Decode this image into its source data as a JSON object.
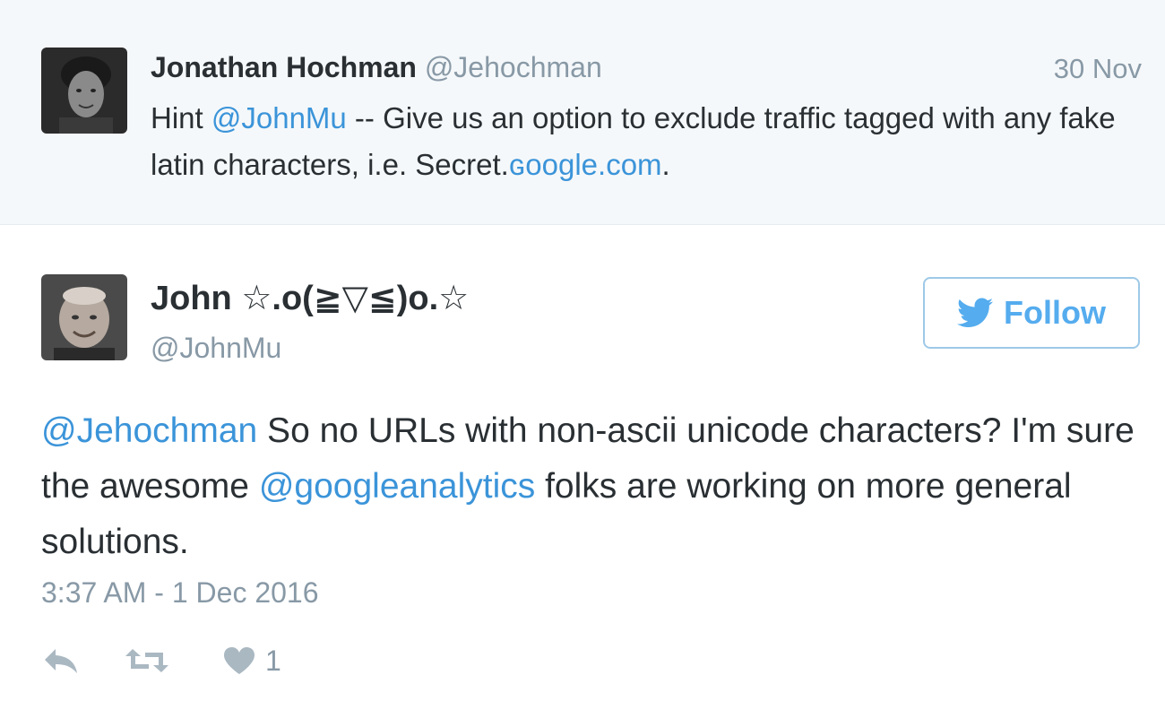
{
  "parent_tweet": {
    "fullname": "Jonathan Hochman",
    "username": "@Jehochman",
    "time": "30 Nov",
    "text_parts": [
      {
        "text": "Hint ",
        "link": false
      },
      {
        "text": "@JohnMu",
        "link": true
      },
      {
        "text": " -- Give us an option to exclude traffic tagged with any fake latin characters, i.e. Secret.",
        "link": false
      },
      {
        "text": "ɢoogle.com",
        "link": true
      },
      {
        "text": ".",
        "link": false
      }
    ]
  },
  "tweet": {
    "fullname": "John ☆.o(≧▽≦)o.☆",
    "username": "@JohnMu",
    "follow_label": "Follow",
    "text_parts": [
      {
        "text": "@Jehochman",
        "link": true
      },
      {
        "text": " So no URLs with non-ascii unicode characters? I'm sure the awesome ",
        "link": false
      },
      {
        "text": "@googleanalytics",
        "link": true
      },
      {
        "text": " folks are working on more general solutions.",
        "link": false
      }
    ],
    "timestamp": "3:37 AM - 1 Dec 2016",
    "like_count": "1"
  },
  "icons": {
    "reply": "reply-icon",
    "retweet": "retweet-icon",
    "like": "heart-icon",
    "follow": "twitter-bird-icon"
  },
  "colors": {
    "link": "#3b94d9",
    "muted": "#8899a6",
    "text": "#292f33",
    "parent_bg": "#f5f8fa",
    "follow_blue": "#55acee",
    "action_gray": "#aab8c2"
  }
}
